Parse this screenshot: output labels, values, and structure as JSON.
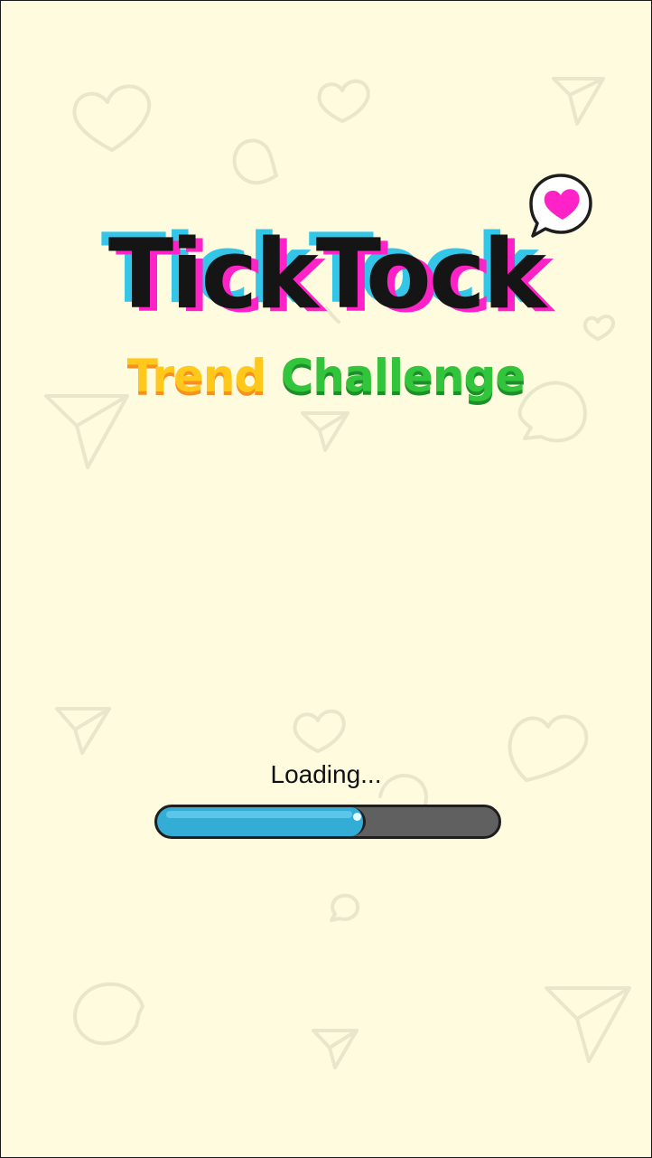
{
  "logo": {
    "title": "TickTock",
    "subtitle_word1": "Trend",
    "subtitle_word2": "Challenge",
    "bubble_icon": "heart-speech-bubble-icon"
  },
  "loading": {
    "label": "Loading...",
    "progress_fraction": 0.61
  },
  "background": {
    "pattern_icons": [
      "heart-outline-icon",
      "speech-bubble-outline-icon",
      "paper-plane-outline-icon"
    ],
    "color": "#fefbdf",
    "pattern_color": "#e8e7cc"
  },
  "colors": {
    "cyan": "#33c6e8",
    "magenta": "#ff22c7",
    "trend_yellow": "#ffc81a",
    "challenge_green": "#32c43a",
    "bar_fill": "#33acd6",
    "bar_track": "#606060"
  }
}
